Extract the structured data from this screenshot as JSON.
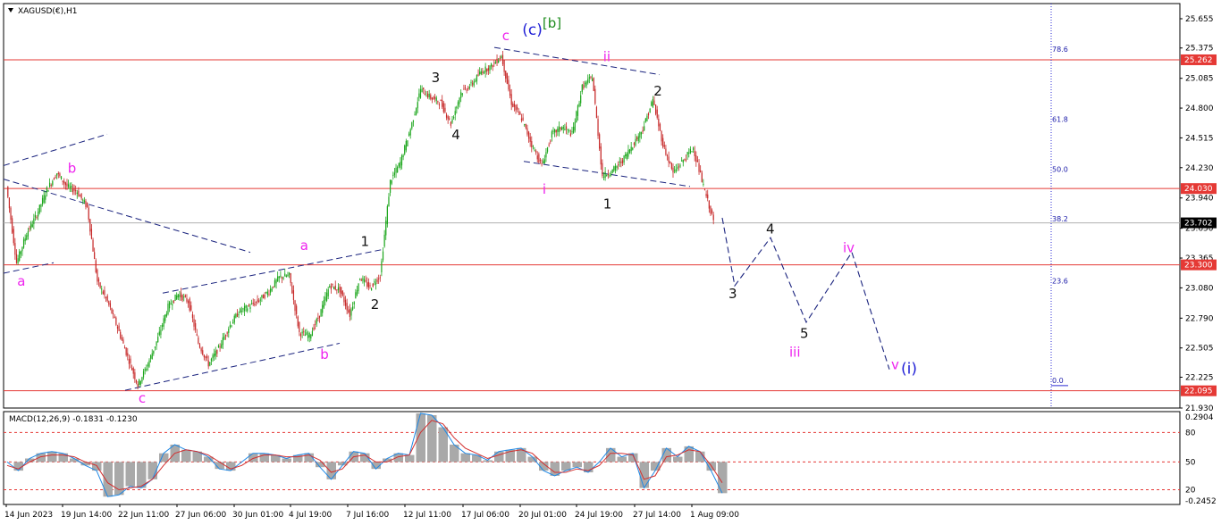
{
  "window": {
    "symbol_title": "XAGUSD(€),H1",
    "menu_icon": "triangle-down-icon"
  },
  "colors": {
    "up_candle": "#1aa51a",
    "down_candle": "#c62828",
    "level_line": "#e53935",
    "channel_line": "#1a237e",
    "fib_line": "#2b2bd4",
    "magenta": "#ee24ee",
    "blue_label": "#1f1fd6",
    "green_label": "#1e8c1e",
    "label_dark": "#111111",
    "macd_hist": "#a9a9a9",
    "macd_signal": "#d32f2f",
    "macd_line": "#1e88e5"
  },
  "chart_data": [
    {
      "type": "candlestick",
      "title": "XAGUSD(€),H1",
      "ylim": [
        21.93,
        25.8
      ],
      "y_ticks": [
        21.93,
        22.225,
        22.505,
        22.79,
        23.08,
        23.365,
        23.65,
        23.94,
        24.23,
        24.515,
        24.8,
        25.085,
        25.375,
        25.655
      ],
      "x_ticks": [
        "14 Jun 2023",
        "19 Jun 14:00",
        "22 Jun 11:00",
        "27 Jun 06:00",
        "30 Jun 01:00",
        "4 Jul 19:00",
        "7 Jul 16:00",
        "12 Jul 11:00",
        "17 Jul 06:00",
        "20 Jul 01:00",
        "24 Jul 19:00",
        "27 Jul 14:00",
        "1 Aug 09:00"
      ],
      "price_path": [
        [
          0,
          24.05
        ],
        [
          1,
          23.32
        ],
        [
          2,
          23.6
        ],
        [
          3,
          23.78
        ],
        [
          4,
          24.02
        ],
        [
          5,
          24.18
        ],
        [
          6,
          24.05
        ],
        [
          7,
          24.0
        ],
        [
          8,
          23.85
        ],
        [
          9,
          23.14
        ],
        [
          10,
          22.95
        ],
        [
          11,
          22.7
        ],
        [
          12,
          22.42
        ],
        [
          13,
          22.15
        ],
        [
          14,
          22.35
        ],
        [
          15,
          22.6
        ],
        [
          16,
          22.9
        ],
        [
          17,
          23.02
        ],
        [
          18,
          22.95
        ],
        [
          19,
          22.55
        ],
        [
          20,
          22.35
        ],
        [
          21,
          22.5
        ],
        [
          22,
          22.7
        ],
        [
          23,
          22.85
        ],
        [
          24,
          22.9
        ],
        [
          25,
          22.96
        ],
        [
          26,
          23.05
        ],
        [
          27,
          23.18
        ],
        [
          28,
          23.2
        ],
        [
          29,
          22.65
        ],
        [
          30,
          22.62
        ],
        [
          31,
          22.82
        ],
        [
          32,
          23.1
        ],
        [
          33,
          23.06
        ],
        [
          34,
          22.82
        ],
        [
          35,
          23.18
        ],
        [
          36,
          23.08
        ],
        [
          37,
          23.2
        ],
        [
          38,
          24.1
        ],
        [
          39,
          24.28
        ],
        [
          40,
          24.6
        ],
        [
          41,
          24.98
        ],
        [
          42,
          24.9
        ],
        [
          43,
          24.85
        ],
        [
          44,
          24.65
        ],
        [
          45,
          24.95
        ],
        [
          46,
          25.02
        ],
        [
          47,
          25.15
        ],
        [
          48,
          25.2
        ],
        [
          49,
          25.3
        ],
        [
          50,
          24.85
        ],
        [
          51,
          24.7
        ],
        [
          52,
          24.45
        ],
        [
          53,
          24.25
        ],
        [
          54,
          24.55
        ],
        [
          55,
          24.62
        ],
        [
          56,
          24.55
        ],
        [
          57,
          25.0
        ],
        [
          58,
          25.1
        ],
        [
          59,
          24.15
        ],
        [
          60,
          24.2
        ],
        [
          61,
          24.3
        ],
        [
          62,
          24.45
        ],
        [
          63,
          24.6
        ],
        [
          64,
          24.88
        ],
        [
          65,
          24.45
        ],
        [
          66,
          24.18
        ],
        [
          67,
          24.3
        ],
        [
          68,
          24.42
        ],
        [
          69,
          24.05
        ],
        [
          70,
          23.72
        ]
      ],
      "levels": [
        25.262,
        24.03,
        23.3,
        22.095
      ],
      "level_labels": [
        "25.262",
        "24.030",
        "23.300",
        "22.095"
      ],
      "current_price": 23.702,
      "current_price_label": "23.702",
      "fibonacci": [
        {
          "label": "78.6",
          "price": 25.34
        },
        {
          "label": "61.8",
          "price": 24.67
        },
        {
          "label": "50.0",
          "price": 24.19
        },
        {
          "label": "38.2",
          "price": 23.715
        },
        {
          "label": "23.6",
          "price": 23.12
        },
        {
          "label": "0.0",
          "price": 22.17
        }
      ],
      "wave_labels": [
        {
          "text": "b",
          "bar": 6,
          "price": 24.18,
          "style": "magenta"
        },
        {
          "text": "a",
          "bar": 1,
          "price": 23.1,
          "style": "magenta"
        },
        {
          "text": "c",
          "bar": 13,
          "price": 21.98,
          "style": "magenta"
        },
        {
          "text": "a",
          "bar": 29,
          "price": 23.44,
          "style": "magenta"
        },
        {
          "text": "b",
          "bar": 31,
          "price": 22.4,
          "style": "magenta"
        },
        {
          "text": "1",
          "bar": 35,
          "price": 23.48,
          "style": "dark"
        },
        {
          "text": "2",
          "bar": 36,
          "price": 22.88,
          "style": "dark"
        },
        {
          "text": "3",
          "bar": 42,
          "price": 25.05,
          "style": "dark"
        },
        {
          "text": "4",
          "bar": 44,
          "price": 24.5,
          "style": "dark"
        },
        {
          "text": "c",
          "bar": 49,
          "price": 25.45,
          "style": "magenta"
        },
        {
          "text": "(c)",
          "bar": 51,
          "price": 25.5,
          "style": "blue"
        },
        {
          "text": "[b]",
          "bar": 53,
          "price": 25.57,
          "style": "green"
        },
        {
          "text": "ii",
          "bar": 59,
          "price": 25.25,
          "style": "magenta"
        },
        {
          "text": "i",
          "bar": 53,
          "price": 23.98,
          "style": "magenta"
        },
        {
          "text": "1",
          "bar": 59,
          "price": 23.84,
          "style": "dark"
        },
        {
          "text": "2",
          "bar": 64,
          "price": 24.92,
          "style": "dark"
        }
      ],
      "projection_labels": [
        {
          "text": "3",
          "price": 22.98,
          "style": "dark"
        },
        {
          "text": "4",
          "price": 23.6,
          "style": "dark"
        },
        {
          "text": "5",
          "price": 22.6,
          "style": "dark"
        },
        {
          "text": "iii",
          "price": 22.42,
          "style": "magenta"
        },
        {
          "text": "iv",
          "price": 23.42,
          "style": "magenta"
        },
        {
          "text": "v",
          "price": 22.3,
          "style": "magenta"
        },
        {
          "text": "(i)",
          "price": 22.26,
          "style": "blue"
        }
      ],
      "projection_path": [
        23.75,
        23.1,
        23.56,
        22.75,
        23.42,
        22.3
      ]
    },
    {
      "type": "line",
      "title": "MACD(12,26,9) -0.1831 -0.1230",
      "ylim": [
        -0.2452,
        0.2904
      ],
      "y_ticks": [
        0.2904,
        80,
        50,
        20,
        -0.2452
      ],
      "y_tick_labels": [
        "0.2904",
        "80",
        "50",
        "20",
        "-0.2452"
      ],
      "series": [
        {
          "name": "MACD",
          "values": [
            0.0,
            -0.05,
            0.02,
            0.05,
            0.06,
            0.05,
            0.02,
            -0.02,
            -0.05,
            -0.2,
            -0.19,
            -0.14,
            -0.15,
            -0.1,
            0.05,
            0.1,
            0.07,
            0.06,
            0.03,
            -0.04,
            -0.05,
            0.0,
            0.05,
            0.05,
            0.04,
            0.02,
            0.04,
            0.05,
            -0.03,
            -0.1,
            -0.02,
            0.06,
            0.05,
            -0.04,
            0.02,
            0.05,
            0.04,
            0.28,
            0.27,
            0.2,
            0.1,
            0.05,
            0.04,
            0.01,
            0.06,
            0.07,
            0.08,
            0.03,
            -0.05,
            -0.08,
            -0.05,
            -0.03,
            -0.06,
            0.0,
            0.08,
            0.03,
            0.05,
            -0.15,
            -0.05,
            0.08,
            0.03,
            0.09,
            0.06,
            -0.05,
            -0.18
          ]
        },
        {
          "name": "Signal",
          "values": [
            -0.02,
            -0.04,
            0.0,
            0.03,
            0.04,
            0.04,
            0.03,
            0.0,
            -0.02,
            -0.12,
            -0.16,
            -0.15,
            -0.14,
            -0.1,
            -0.02,
            0.05,
            0.07,
            0.06,
            0.04,
            0.0,
            -0.04,
            -0.02,
            0.02,
            0.04,
            0.04,
            0.03,
            0.03,
            0.04,
            0.01,
            -0.06,
            -0.04,
            0.03,
            0.04,
            0.0,
            0.0,
            0.03,
            0.04,
            0.17,
            0.24,
            0.22,
            0.14,
            0.08,
            0.05,
            0.02,
            0.04,
            0.06,
            0.07,
            0.05,
            -0.01,
            -0.06,
            -0.06,
            -0.04,
            -0.05,
            -0.02,
            0.05,
            0.05,
            0.04,
            -0.1,
            -0.08,
            0.03,
            0.04,
            0.07,
            0.06,
            -0.02,
            -0.12
          ]
        }
      ]
    }
  ]
}
